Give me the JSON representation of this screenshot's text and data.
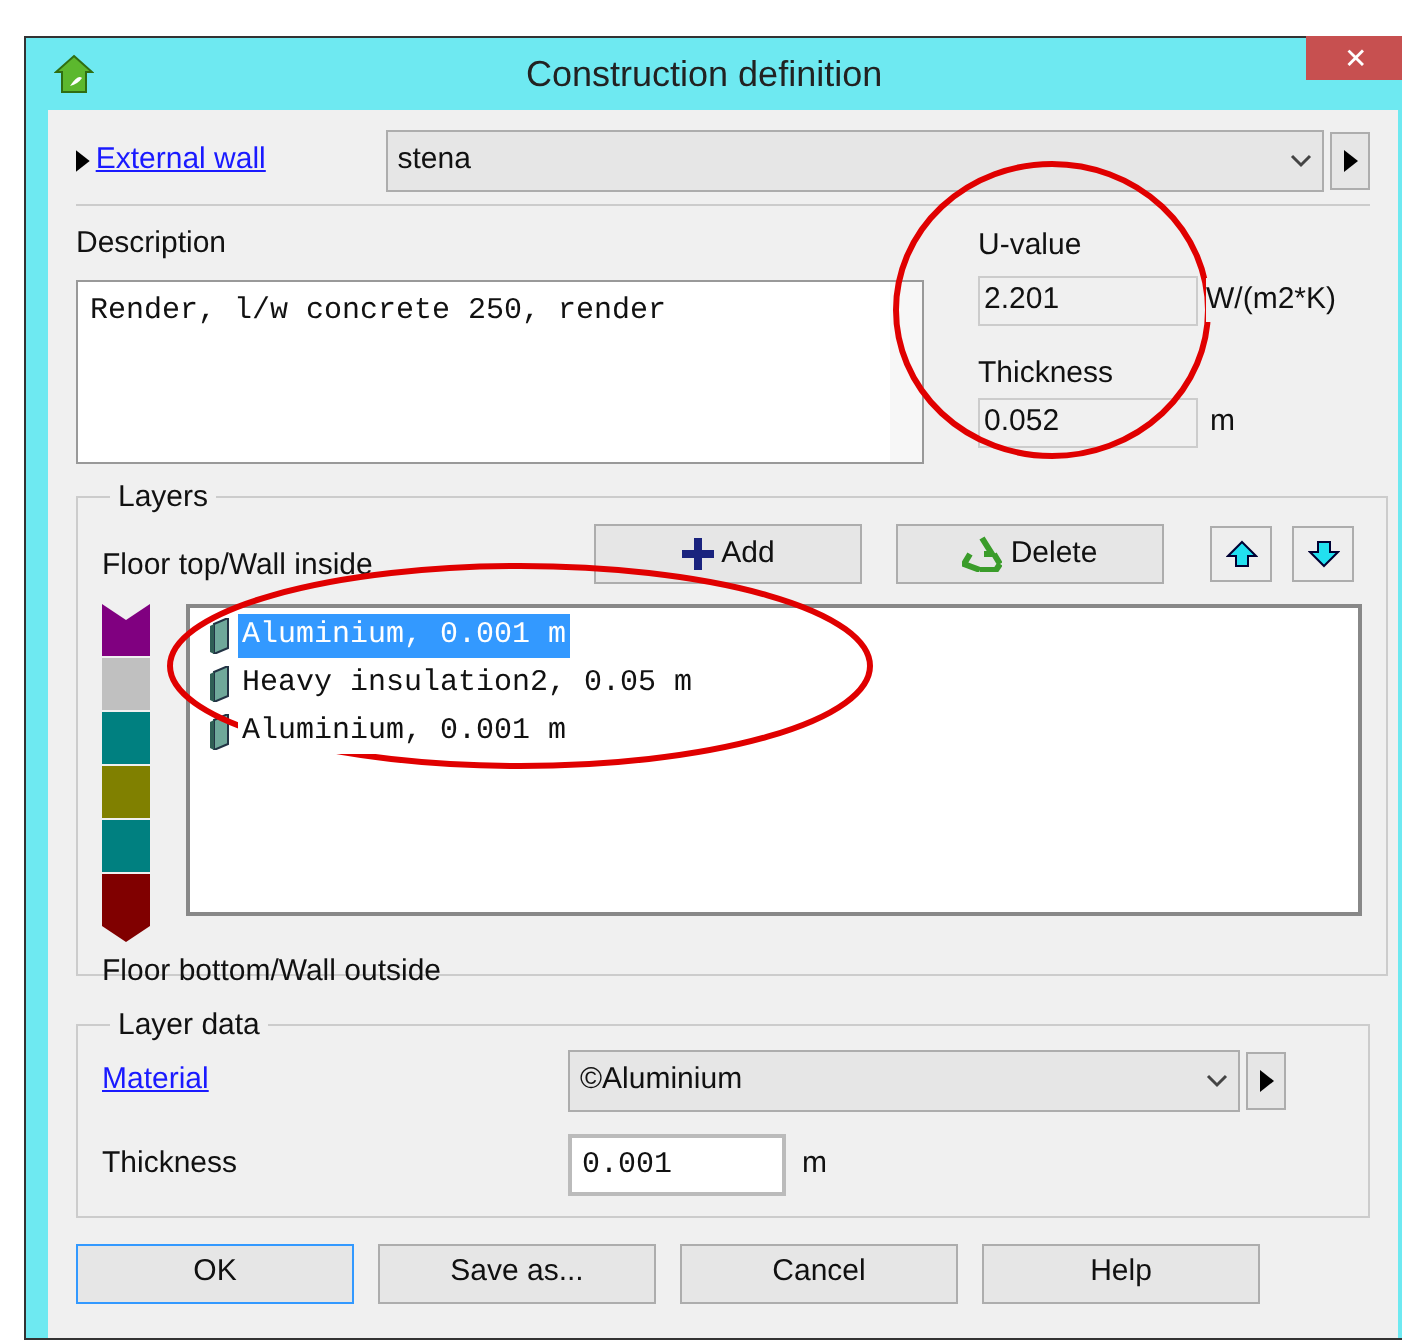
{
  "window": {
    "title": "Construction definition",
    "close": "✕"
  },
  "construction": {
    "type_link": "External wall",
    "name": "stena"
  },
  "description": {
    "label": "Description",
    "value": "Render, l/w concrete 250, render"
  },
  "u_value": {
    "label": "U-value",
    "value": "2.201",
    "unit": "W/(m2*K)"
  },
  "thickness": {
    "label": "Thickness",
    "value": "0.052",
    "unit": "m"
  },
  "layers": {
    "title": "Layers",
    "top_label": "Floor top/Wall inside",
    "bottom_label": "Floor bottom/Wall outside",
    "add": "Add",
    "delete": "Delete",
    "strip": [
      {
        "color": "#800080"
      },
      {
        "color": "#c0c0c0"
      },
      {
        "color": "#008080"
      },
      {
        "color": "#808000"
      },
      {
        "color": "#008080"
      },
      {
        "color": "#800000"
      }
    ],
    "items": [
      {
        "label": "Aluminium, 0.001 m",
        "selected": true
      },
      {
        "label": "Heavy insulation2, 0.05 m",
        "selected": false
      },
      {
        "label": "Aluminium, 0.001 m",
        "selected": false
      }
    ]
  },
  "layer_data": {
    "title": "Layer data",
    "material_link": "Material",
    "material": "©Aluminium",
    "thickness_label": "Thickness",
    "thickness": "0.001",
    "unit": "m"
  },
  "buttons": [
    {
      "label": "OK",
      "default": true
    },
    {
      "label": "Save as...",
      "default": false
    },
    {
      "label": "Cancel",
      "default": false
    },
    {
      "label": "Help",
      "default": false
    }
  ],
  "highlights": [
    {
      "kind": "ellipse"
    },
    {
      "kind": "ellipse"
    }
  ]
}
